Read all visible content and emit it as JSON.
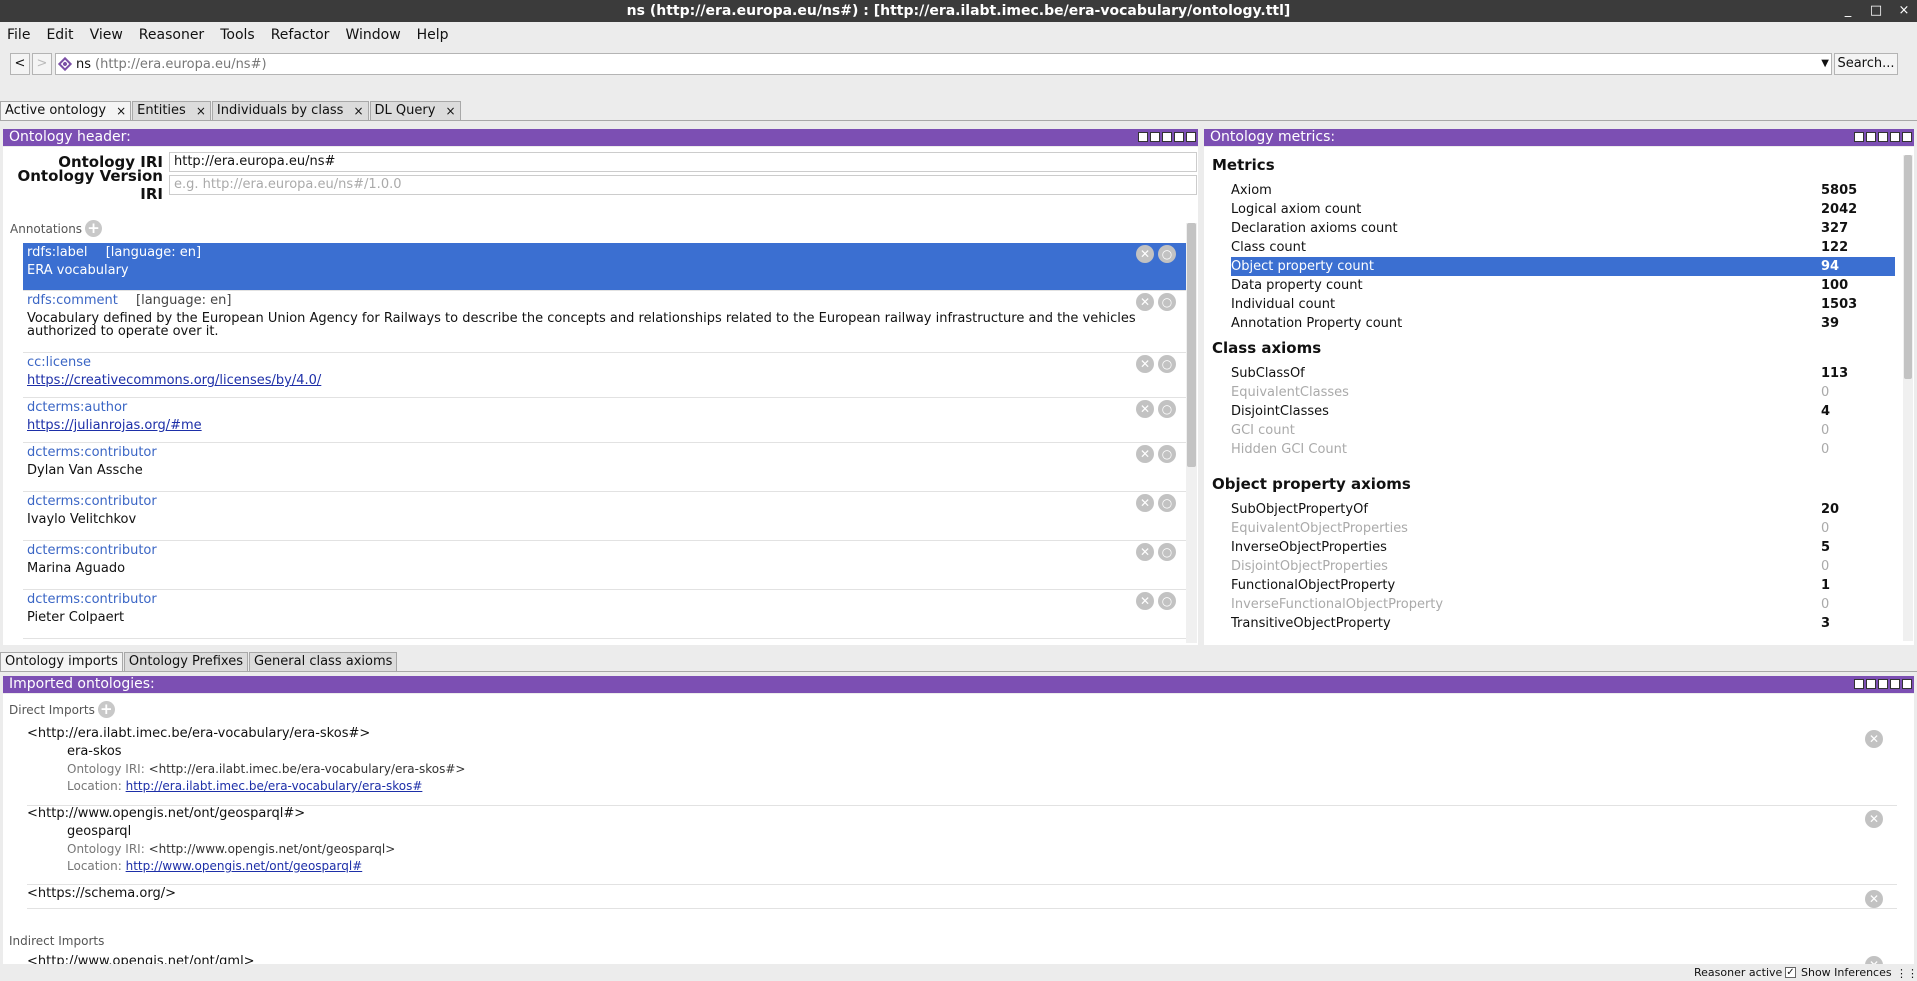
{
  "window": {
    "title": "ns (http://era.europa.eu/ns#)  : [http://era.ilabt.imec.be/era-vocabulary/ontology.ttl]",
    "controls": [
      "_",
      "□",
      "×"
    ]
  },
  "menu": [
    "File",
    "Edit",
    "View",
    "Reasoner",
    "Tools",
    "Refactor",
    "Window",
    "Help"
  ],
  "nav": {
    "back": "<",
    "forward": ">",
    "prefix": "ns",
    "iri": "(http://era.europa.eu/ns#)",
    "search": "Search..."
  },
  "tabs": [
    {
      "label": "Active ontology",
      "close": "×"
    },
    {
      "label": "Entities",
      "close": "×"
    },
    {
      "label": "Individuals by class",
      "close": "×"
    },
    {
      "label": "DL Query",
      "close": "×"
    }
  ],
  "header_panel": {
    "title": "Ontology header:",
    "iri_label": "Ontology IRI",
    "iri_value": "http://era.europa.eu/ns#",
    "version_label": "Ontology Version IRI",
    "version_placeholder": "e.g. http://era.europa.eu/ns#/1.0.0",
    "annotations_title": "Annotations",
    "annotations": [
      {
        "prop": "rdfs:label",
        "lang": "[language: en]",
        "value": "ERA vocabulary"
      },
      {
        "prop": "rdfs:comment",
        "lang": "[language: en]",
        "value": "Vocabulary defined by the European Union Agency for Railways to describe the concepts and relationships related to the European railway infrastructure and the vehicles authorized to operate over it."
      },
      {
        "prop": "cc:license",
        "lang": "",
        "value": "https://creativecommons.org/licenses/by/4.0/"
      },
      {
        "prop": "dcterms:author",
        "lang": "",
        "value": "https://julianrojas.org/#me"
      },
      {
        "prop": "dcterms:contributor",
        "lang": "",
        "value": "Dylan Van Assche"
      },
      {
        "prop": "dcterms:contributor",
        "lang": "",
        "value": "Ivaylo Velitchkov"
      },
      {
        "prop": "dcterms:contributor",
        "lang": "",
        "value": "Marina Aguado"
      },
      {
        "prop": "dcterms:contributor",
        "lang": "",
        "value": "Pieter Colpaert"
      }
    ]
  },
  "metrics_panel": {
    "title": "Ontology metrics:",
    "sections": [
      {
        "heading": "Metrics",
        "rows": [
          {
            "label": "Axiom",
            "value": "5805"
          },
          {
            "label": "Logical axiom count",
            "value": "2042"
          },
          {
            "label": "Declaration axioms count",
            "value": "327"
          },
          {
            "label": "Class count",
            "value": "122"
          },
          {
            "label": "Object property count",
            "value": "94"
          },
          {
            "label": "Data property count",
            "value": "100"
          },
          {
            "label": "Individual count",
            "value": "1503"
          },
          {
            "label": "Annotation Property count",
            "value": "39"
          }
        ]
      },
      {
        "heading": "Class axioms",
        "rows": [
          {
            "label": "SubClassOf",
            "value": "113"
          },
          {
            "label": "EquivalentClasses",
            "value": "0"
          },
          {
            "label": "DisjointClasses",
            "value": "4"
          },
          {
            "label": "GCI count",
            "value": "0"
          },
          {
            "label": "Hidden GCI Count",
            "value": "0"
          }
        ]
      },
      {
        "heading": "Object property axioms",
        "rows": [
          {
            "label": "SubObjectPropertyOf",
            "value": "20"
          },
          {
            "label": "EquivalentObjectProperties",
            "value": "0"
          },
          {
            "label": "InverseObjectProperties",
            "value": "5"
          },
          {
            "label": "DisjointObjectProperties",
            "value": "0"
          },
          {
            "label": "FunctionalObjectProperty",
            "value": "1"
          },
          {
            "label": "InverseFunctionalObjectProperty",
            "value": "0"
          },
          {
            "label": "TransitiveObjectProperty",
            "value": "3"
          }
        ]
      }
    ]
  },
  "bottom_tabs": [
    "Ontology imports",
    "Ontology Prefixes",
    "General class axioms"
  ],
  "imports_panel": {
    "title": "Imported ontologies:",
    "direct_title": "Direct Imports",
    "indirect_title": "Indirect Imports",
    "iri_prefix": "Ontology IRI:",
    "loc_prefix": "Location:",
    "direct": [
      {
        "uri": "<http://era.ilabt.imec.be/era-vocabulary/era-skos#>",
        "name": "era-skos",
        "iri": "<http://era.ilabt.imec.be/era-vocabulary/era-skos#>",
        "location": "http://era.ilabt.imec.be/era-vocabulary/era-skos#"
      },
      {
        "uri": "<http://www.opengis.net/ont/geosparql#>",
        "name": "geosparql",
        "iri": "<http://www.opengis.net/ont/geosparql>",
        "location": "http://www.opengis.net/ont/geosparql#"
      },
      {
        "uri": "<https://schema.org/>"
      }
    ],
    "indirect_first": "<http://www.opengis.net/ont/gml>"
  },
  "status": {
    "reasoner": "Reasoner active",
    "show_inferences": "Show Inferences",
    "check": "✓"
  },
  "colors": {
    "accent": "#7c4fb3",
    "selection": "#3b6fd1",
    "link": "#3b66c5"
  }
}
